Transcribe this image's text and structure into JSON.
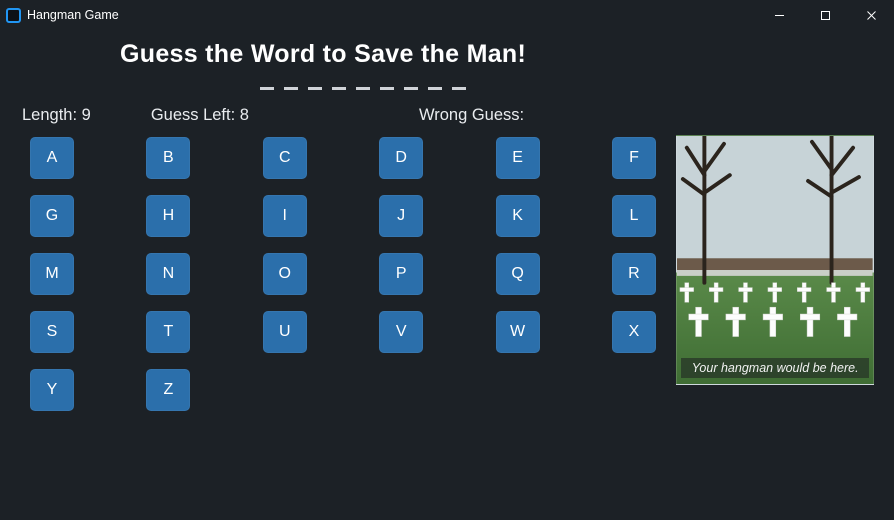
{
  "window": {
    "title": "Hangman Game"
  },
  "header": {
    "title": "Guess the Word to Save the Man!"
  },
  "status": {
    "length_label": "Length: 9",
    "length_value": 9,
    "guess_left_label": "Guess Left: 8",
    "guess_left_value": 8,
    "wrong_label": "Wrong Guess:",
    "wrong_value": ""
  },
  "word": {
    "slots": 9
  },
  "letters": [
    "A",
    "B",
    "C",
    "D",
    "E",
    "F",
    "G",
    "H",
    "I",
    "J",
    "K",
    "L",
    "M",
    "N",
    "O",
    "P",
    "Q",
    "R",
    "S",
    "T",
    "U",
    "V",
    "W",
    "X",
    "Y",
    "Z"
  ],
  "panel": {
    "caption": "Your hangman would be here."
  },
  "colors": {
    "button": "#2b6fab",
    "background": "#1c2126"
  }
}
